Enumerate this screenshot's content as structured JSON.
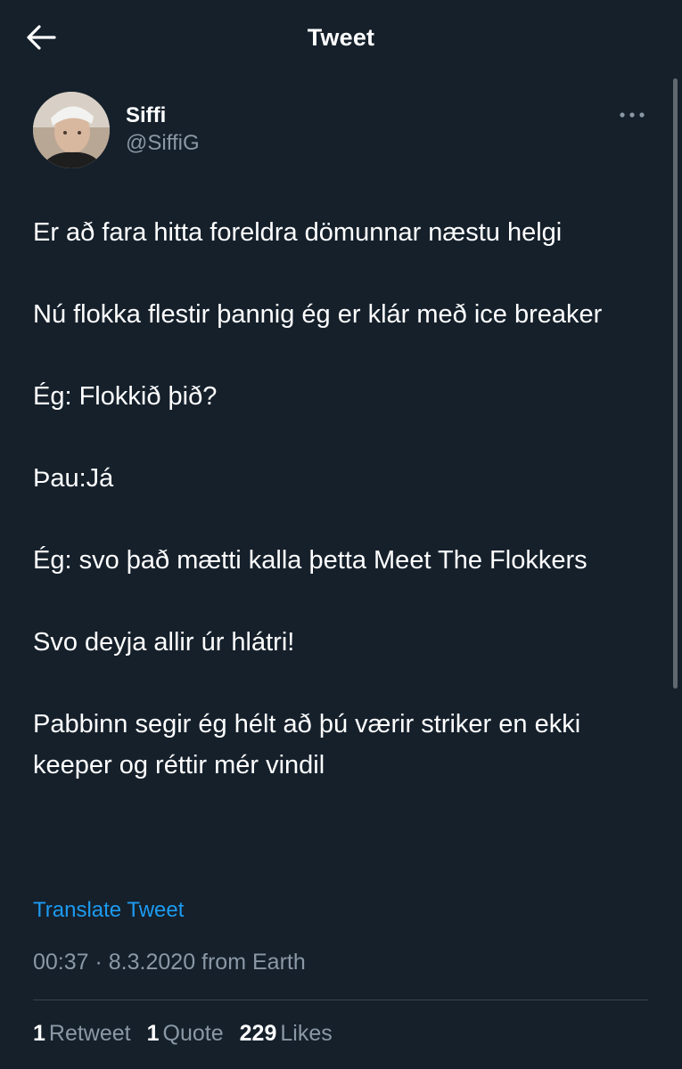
{
  "header": {
    "title": "Tweet",
    "back_icon": "arrow-left-icon"
  },
  "author": {
    "name": "Siffi",
    "handle": "@SiffiG",
    "more_icon": "more-horizontal-icon"
  },
  "tweet": {
    "paragraphs": [
      "Er að fara hitta foreldra dömunnar næstu helgi",
      "Nú flokka flestir þannig ég er klár með ice breaker",
      "Ég: Flokkið þið?",
      "Þau:Já",
      "Ég: svo það mætti kalla þetta Meet The Flokkers",
      "Svo deyja allir úr hlátri!",
      "Pabbinn segir ég hélt að þú værir striker en ekki keeper og réttir mér vindil"
    ],
    "translate_label": "Translate Tweet",
    "timestamp": "00:37 · 8.3.2020 from Earth"
  },
  "stats": {
    "retweets_count": "1",
    "retweets_label": "Retweet",
    "quotes_count": "1",
    "quotes_label": "Quote",
    "likes_count": "229",
    "likes_label": "Likes"
  },
  "colors": {
    "background": "#15202b",
    "accent": "#1d9bf0",
    "secondary_text": "#8b98a5"
  }
}
